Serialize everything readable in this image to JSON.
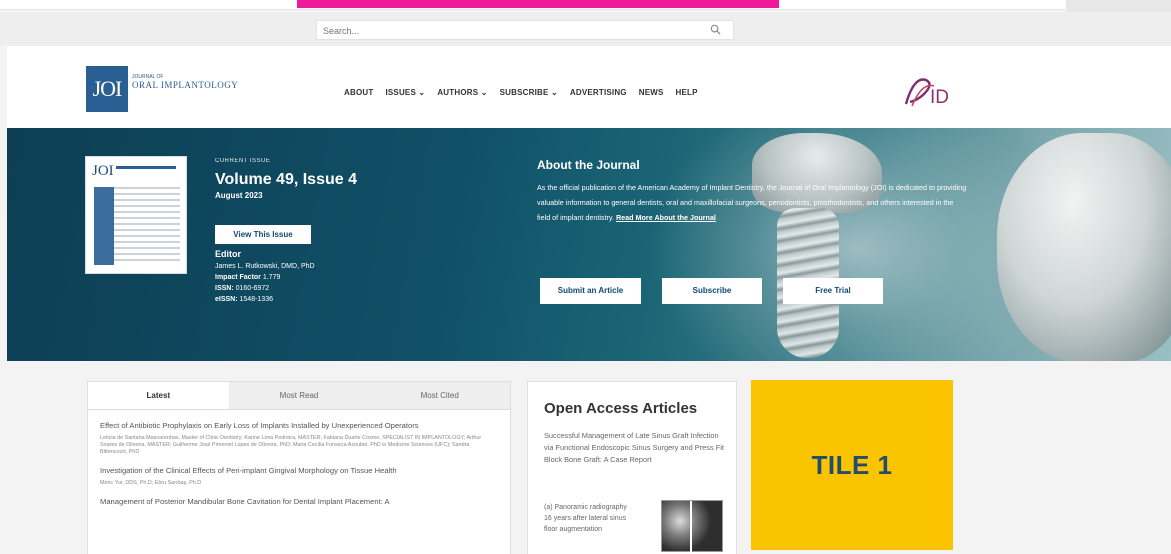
{
  "search": {
    "placeholder": "Search..."
  },
  "header": {
    "logo_text": "JOI",
    "logo_journal": "ORAL IMPLANTOLOGY",
    "logo_small": "JOURNAL OF",
    "nav": [
      "ABOUT",
      "ISSUES ⌄",
      "AUTHORS ⌄",
      "SUBSCRIBE ⌄",
      "ADVERTISING",
      "NEWS",
      "HELP"
    ],
    "partner_logo": "AAID"
  },
  "hero": {
    "current_issue_label": "CURRENT ISSUE",
    "volume": "Volume 49, Issue 4",
    "date": "August 2023",
    "view_button": "View This Issue",
    "editor_label": "Editor",
    "editor_name": "James L. Rutkowski, DMD, PhD",
    "impact_label": "Impact Factor",
    "impact_value": "1.779",
    "issn_label": "ISSN:",
    "issn_value": "0160-6972",
    "eissn_label": "eISSN:",
    "eissn_value": "1548-1336",
    "about_title": "About the Journal",
    "about_text": "As the official publication of the American Academy of Implant Dentistry, the Journal of Oral Implantology (JOI) is dedicated to providing valuable information to general dentists, oral and maxillofacial surgeons, periodontists, prosthodontists, and others interested in the field of implant dentistry.",
    "read_more": "Read More About the Journal",
    "buttons": {
      "submit": "Submit an Article",
      "subscribe": "Subscribe",
      "trial": "Free Trial"
    },
    "cover_text": "JOI"
  },
  "tabs": [
    "Latest",
    "Most Read",
    "Most Cited"
  ],
  "articles": [
    {
      "title": "Effect of Antibiotic Prophylaxis on Early Loss of Implants Installed by Unexperienced Operators",
      "authors": "Leticia de Santana Mascarenhas, Master of Clinic Dentistry; Karine Lima Pedreira, MASTER; Fabiana Duarte Cosme, SPECIALIST IN IMPLANTOLOGY; Arthur Soares de Oliveira, MASTER; Guilherme José Pimentel Lopes de Oliveira, PhD; Maria Cecília Fonseca Azoubel, PhD in Medicine Sciences (UFC); Sandra Bittencourt, PhD"
    },
    {
      "title": "Investigation of the Clinical Effects of Peri-implant Gingival Morphology on Tissue Health",
      "authors": "Meric Yur, DDS, Ph.D; Ebru Sarıbaş, Ph.D"
    },
    {
      "title": "Management of Posterior Mandibular Bone Cavitation for Dental Implant Placement: A",
      "authors": ""
    }
  ],
  "open_access": {
    "title": "Open Access Articles",
    "article": "Successful Management of Late Sinus Graft Infection via Functional Endoscopic Sinus Surgery and Press Fit Block Bone Graft: A Case Report",
    "caption": "(a) Panoramic radiography 16 years after lateral sinus floor augmentation"
  },
  "tile": {
    "label": "TILE 1"
  },
  "colors": {
    "pink": "#f0199a",
    "brand_blue": "#2a5f93",
    "tile_yellow": "#fbc400",
    "hero_dark": "#0d3e54"
  }
}
